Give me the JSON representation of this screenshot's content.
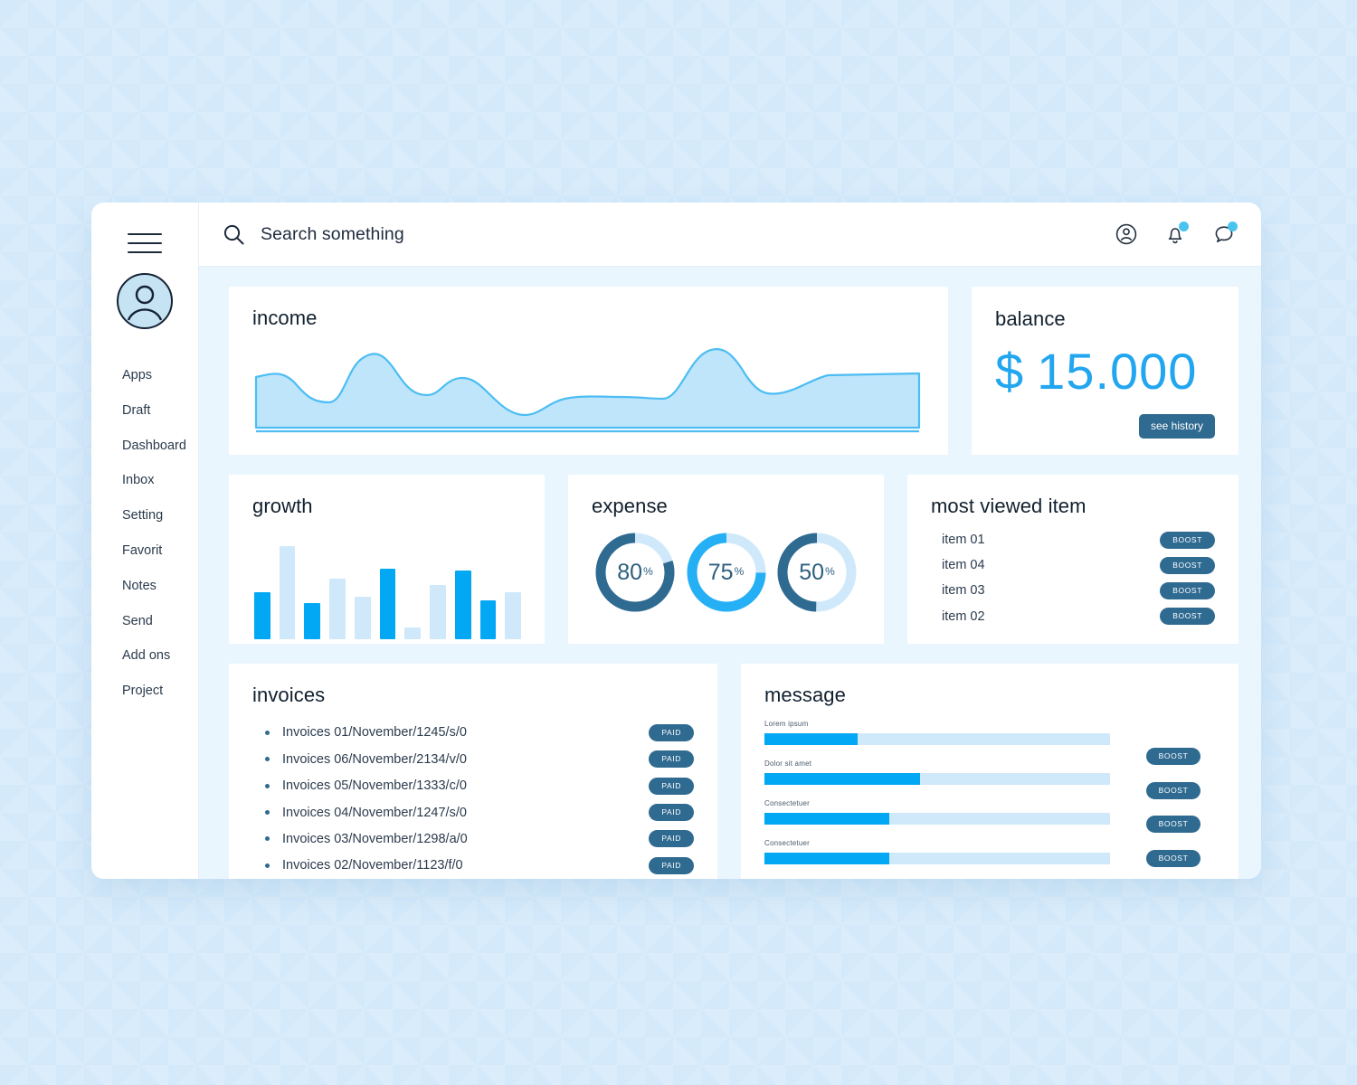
{
  "colors": {
    "page_bg": "#d4eafb",
    "content_bg": "#eaf6fe",
    "accent_blue": "#02a8f3",
    "light_blue": "#cfe9fb",
    "dark_teal": "#2f6a91",
    "balance_blue": "#22a6ef",
    "text_dark": "#2b3b4d"
  },
  "sidebar": {
    "menu_icon": "hamburger-icon",
    "avatar_icon": "user-avatar-icon",
    "items": [
      {
        "label": "Apps"
      },
      {
        "label": "Draft"
      },
      {
        "label": "Dashboard"
      },
      {
        "label": "Inbox"
      },
      {
        "label": "Setting"
      },
      {
        "label": "Favorit"
      },
      {
        "label": "Notes"
      },
      {
        "label": "Send"
      },
      {
        "label": "Add ons"
      },
      {
        "label": "Project"
      }
    ]
  },
  "topbar": {
    "search": {
      "icon": "search-icon",
      "placeholder": "Search something",
      "value": ""
    },
    "icons": [
      {
        "name": "user-circle-icon",
        "badge": false
      },
      {
        "name": "bell-icon",
        "badge": true
      },
      {
        "name": "chat-bubble-icon",
        "badge": true
      }
    ]
  },
  "income": {
    "title": "income"
  },
  "balance": {
    "title": "balance",
    "currency_symbol": "$",
    "amount": "15.000",
    "history_button": "see history"
  },
  "growth": {
    "title": "growth"
  },
  "expense": {
    "title": "expense",
    "donuts": [
      {
        "value": "80",
        "unit": "%",
        "color": "dark"
      },
      {
        "value": "75",
        "unit": "%",
        "color": "bright"
      },
      {
        "value": "50",
        "unit": "%",
        "color": "dark"
      }
    ]
  },
  "most_viewed": {
    "title": "most viewed item",
    "boost_label": "BOOST",
    "items": [
      {
        "name": "item 01"
      },
      {
        "name": "item 04"
      },
      {
        "name": "item 03"
      },
      {
        "name": "item 02"
      }
    ]
  },
  "invoices": {
    "title": "invoices",
    "paid_label": "PAID",
    "items": [
      {
        "text": "Invoices 01/November/1245/s/0"
      },
      {
        "text": "Invoices 06/November/2134/v/0"
      },
      {
        "text": "Invoices 05/November/1333/c/0"
      },
      {
        "text": "Invoices 04/November/1247/s/0"
      },
      {
        "text": "Invoices 03/November/1298/a/0"
      },
      {
        "text": "Invoices 02/November/1123/f/0"
      }
    ]
  },
  "message": {
    "title": "message",
    "boost_label": "BOOST",
    "items": [
      {
        "label": "Lorem ipsum"
      },
      {
        "label": "Dolor sit amet"
      },
      {
        "label": "Consectetuer"
      },
      {
        "label": "Consectetuer"
      }
    ]
  },
  "chart_data": [
    {
      "type": "area",
      "title": "income",
      "xlabel": "",
      "ylabel": "",
      "grid": false,
      "legend": "none",
      "x": [
        0,
        1,
        2,
        3,
        4,
        5,
        6,
        7,
        8,
        9,
        10,
        11,
        12,
        13,
        14,
        15,
        16
      ],
      "values": [
        62,
        55,
        30,
        30,
        92,
        60,
        42,
        48,
        70,
        60,
        22,
        12,
        38,
        40,
        38,
        100,
        45,
        38,
        62
      ],
      "ylim": [
        0,
        110
      ]
    },
    {
      "type": "bar",
      "title": "growth",
      "xlabel": "",
      "ylabel": "",
      "grid": false,
      "legend": "none",
      "categories": [
        "1",
        "2",
        "3",
        "4",
        "5",
        "6",
        "7",
        "8",
        "9",
        "10",
        "11"
      ],
      "values": [
        52,
        103,
        40,
        67,
        47,
        78,
        13,
        60,
        76,
        43,
        52
      ],
      "series_colors": [
        "bright",
        "light",
        "bright",
        "light",
        "light",
        "bright",
        "light",
        "light",
        "bright",
        "bright",
        "light"
      ],
      "ylim": [
        0,
        118
      ]
    },
    {
      "type": "pie",
      "title": "expense",
      "legend": "none",
      "labels": [
        "80%",
        "75%",
        "50%"
      ],
      "values": [
        80,
        75,
        50
      ]
    },
    {
      "type": "bar",
      "title": "message",
      "orientation": "horizontal",
      "grid": false,
      "legend": "none",
      "categories": [
        "Lorem ipsum",
        "Dolor sit amet",
        "Consectetuer",
        "Consectetuer"
      ],
      "values": [
        27,
        45,
        36,
        36
      ],
      "xlim": [
        0,
        100
      ]
    }
  ]
}
